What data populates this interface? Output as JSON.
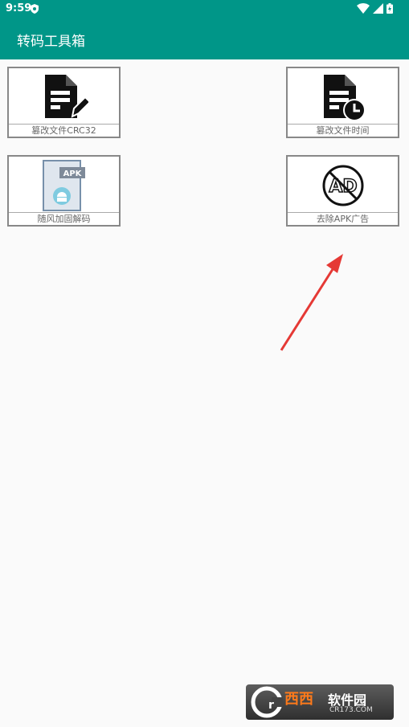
{
  "status_bar": {
    "time": "9:59"
  },
  "app_bar": {
    "title": "转码工具箱"
  },
  "tiles": [
    {
      "label": "篡改文件CRC32",
      "icon": "file-edit-icon"
    },
    {
      "label": "篡改文件时间",
      "icon": "file-clock-icon"
    },
    {
      "label": "随风加固解码",
      "icon": "apk-android-icon",
      "badge": "APK"
    },
    {
      "label": "去除APK广告",
      "icon": "no-ad-icon",
      "icon_text": "AD"
    }
  ],
  "watermark": {
    "brand": "西西",
    "site_name": "软件园",
    "domain": "CR173.COM"
  },
  "colors": {
    "primary": "#009688",
    "arrow": "#e53935"
  }
}
